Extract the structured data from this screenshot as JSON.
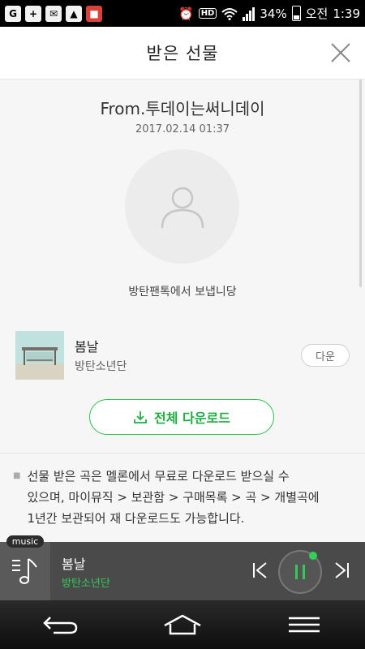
{
  "status_bar": {
    "battery": "34%",
    "ampm": "오전",
    "time": "1:39",
    "hd": "HD"
  },
  "header": {
    "title": "받은 선물"
  },
  "gift": {
    "from": "From.투데이는써니데이",
    "date": "2017.02.14 01:37",
    "message": "방탄팬톡에서 보냅니당"
  },
  "song": {
    "title": "봄날",
    "artist": "방탄소년단",
    "down_label": "다운"
  },
  "download_all_label": "전체 다운로드",
  "notice_lines": [
    "선물 받은 곡은 멜론에서 무료로 다운로드 받으실 수",
    "있으며, 마이뮤직 > 보관함 > 구매목록 > 곡 > 개별곡에",
    "1년간 보관되어 재 다운로드도 가능합니다."
  ],
  "player": {
    "tag": "music",
    "title": "봄날",
    "artist": "방탄소년단"
  },
  "colors": {
    "accent": "#1fae42",
    "player_bg": "#4a4a4a"
  }
}
